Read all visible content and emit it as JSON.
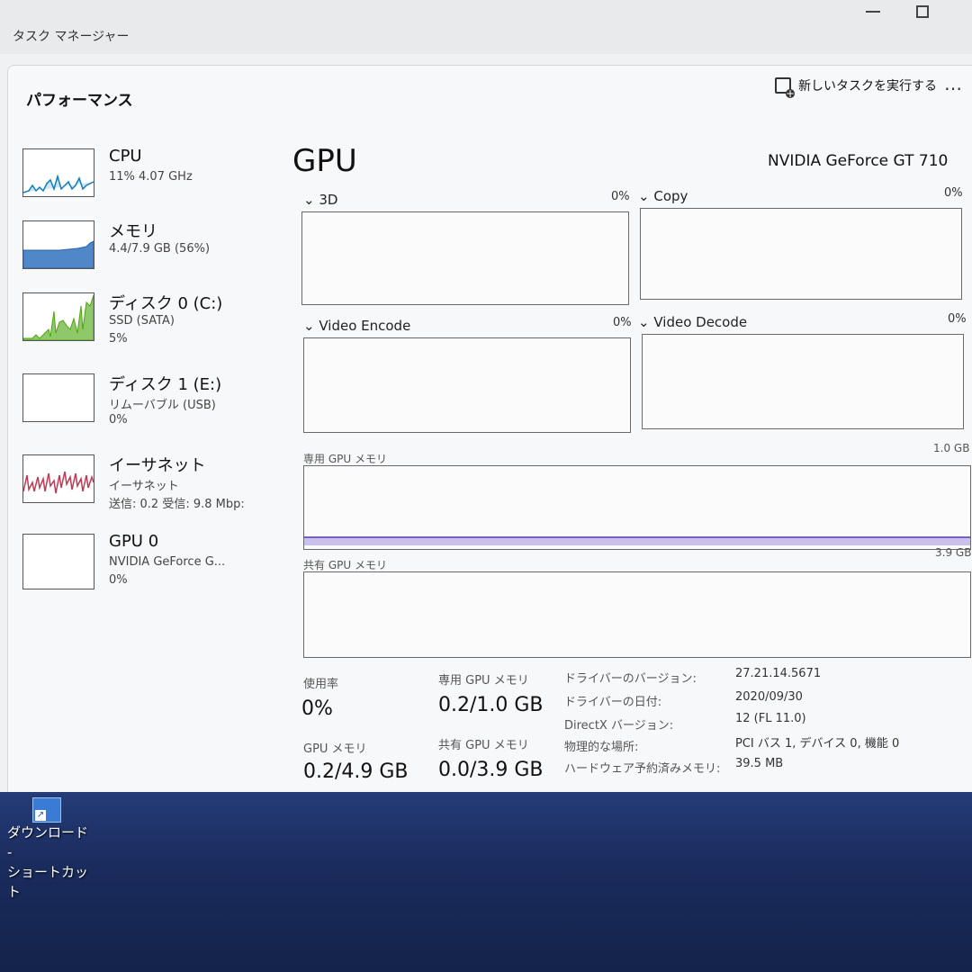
{
  "window": {
    "title": "タスク マネージャー"
  },
  "header": {
    "section_title": "パフォーマンス",
    "run_task_label": "新しいタスクを実行する",
    "more_label": "…"
  },
  "sidebar": {
    "items": [
      {
        "name": "CPU",
        "sub": "11%  4.07 GHz",
        "sub2": ""
      },
      {
        "name": "メモリ",
        "sub": "4.4/7.9 GB (56%)",
        "sub2": ""
      },
      {
        "name": "ディスク 0 (C:)",
        "sub": "SSD (SATA)",
        "sub2": "5%"
      },
      {
        "name": "ディスク 1 (E:)",
        "sub": "リムーバブル (USB)",
        "sub2": "0%"
      },
      {
        "name": "イーサネット",
        "sub": "イーサネット",
        "sub2": "送信: 0.2  受信: 9.8 Mbp:"
      },
      {
        "name": "GPU 0",
        "sub": "NVIDIA GeForce G...",
        "sub2": "0%"
      }
    ]
  },
  "main": {
    "title": "GPU",
    "model": "NVIDIA GeForce GT 710",
    "engines": [
      {
        "label": "3D",
        "pct": "0%"
      },
      {
        "label": "Copy",
        "pct": "0%"
      },
      {
        "label": "Video Encode",
        "pct": "0%"
      },
      {
        "label": "Video Decode",
        "pct": "0%"
      }
    ],
    "dedicated": {
      "label": "専用 GPU メモリ",
      "cap": "1.0 GB",
      "usage_fraction": 0.2
    },
    "shared": {
      "label": "共有 GPU メモリ",
      "cap": "3.9 GB",
      "usage_fraction": 0.0
    },
    "stats": [
      {
        "label": "使用率",
        "value": "0%"
      },
      {
        "label": "専用 GPU メモリ",
        "value": "0.2/1.0 GB"
      },
      {
        "label": "GPU メモリ",
        "value": "0.2/4.9 GB"
      },
      {
        "label": "共有 GPU メモリ",
        "value": "0.0/3.9 GB"
      }
    ],
    "info": [
      {
        "key": "ドライバーのバージョン:",
        "value": "27.21.14.5671"
      },
      {
        "key": "ドライバーの日付:",
        "value": "2020/09/30"
      },
      {
        "key": "DirectX バージョン:",
        "value": "12 (FL 11.0)"
      },
      {
        "key": "物理的な場所:",
        "value": "PCI バス 1, デバイス 0, 機能 0"
      },
      {
        "key": "ハードウェア予約済みメモリ:",
        "value": "39.5 MB"
      }
    ]
  },
  "desktop": {
    "icon_label_1": "ダウンロード -",
    "icon_label_2": "ショートカット"
  },
  "colors": {
    "cpu": "#117dbb",
    "memory": "#8b12ae",
    "disk": "#4da60c",
    "ethernet": "#a74f01",
    "gpu": "#7b5fc7"
  }
}
